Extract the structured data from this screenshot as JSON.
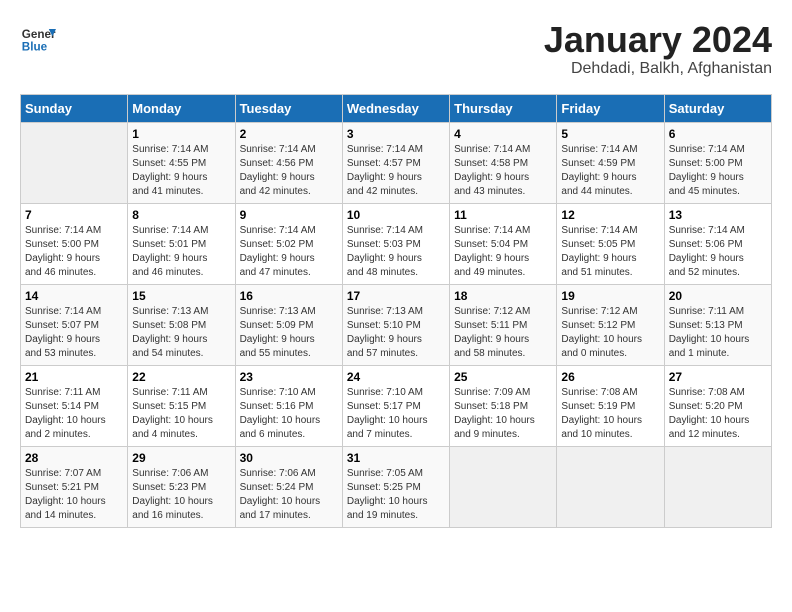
{
  "header": {
    "logo_line1": "General",
    "logo_line2": "Blue",
    "title": "January 2024",
    "subtitle": "Dehdadi, Balkh, Afghanistan"
  },
  "days_of_week": [
    "Sunday",
    "Monday",
    "Tuesday",
    "Wednesday",
    "Thursday",
    "Friday",
    "Saturday"
  ],
  "weeks": [
    [
      {
        "day": "",
        "info": ""
      },
      {
        "day": "1",
        "info": "Sunrise: 7:14 AM\nSunset: 4:55 PM\nDaylight: 9 hours\nand 41 minutes."
      },
      {
        "day": "2",
        "info": "Sunrise: 7:14 AM\nSunset: 4:56 PM\nDaylight: 9 hours\nand 42 minutes."
      },
      {
        "day": "3",
        "info": "Sunrise: 7:14 AM\nSunset: 4:57 PM\nDaylight: 9 hours\nand 42 minutes."
      },
      {
        "day": "4",
        "info": "Sunrise: 7:14 AM\nSunset: 4:58 PM\nDaylight: 9 hours\nand 43 minutes."
      },
      {
        "day": "5",
        "info": "Sunrise: 7:14 AM\nSunset: 4:59 PM\nDaylight: 9 hours\nand 44 minutes."
      },
      {
        "day": "6",
        "info": "Sunrise: 7:14 AM\nSunset: 5:00 PM\nDaylight: 9 hours\nand 45 minutes."
      }
    ],
    [
      {
        "day": "7",
        "info": "Sunrise: 7:14 AM\nSunset: 5:00 PM\nDaylight: 9 hours\nand 46 minutes."
      },
      {
        "day": "8",
        "info": "Sunrise: 7:14 AM\nSunset: 5:01 PM\nDaylight: 9 hours\nand 46 minutes."
      },
      {
        "day": "9",
        "info": "Sunrise: 7:14 AM\nSunset: 5:02 PM\nDaylight: 9 hours\nand 47 minutes."
      },
      {
        "day": "10",
        "info": "Sunrise: 7:14 AM\nSunset: 5:03 PM\nDaylight: 9 hours\nand 48 minutes."
      },
      {
        "day": "11",
        "info": "Sunrise: 7:14 AM\nSunset: 5:04 PM\nDaylight: 9 hours\nand 49 minutes."
      },
      {
        "day": "12",
        "info": "Sunrise: 7:14 AM\nSunset: 5:05 PM\nDaylight: 9 hours\nand 51 minutes."
      },
      {
        "day": "13",
        "info": "Sunrise: 7:14 AM\nSunset: 5:06 PM\nDaylight: 9 hours\nand 52 minutes."
      }
    ],
    [
      {
        "day": "14",
        "info": "Sunrise: 7:14 AM\nSunset: 5:07 PM\nDaylight: 9 hours\nand 53 minutes."
      },
      {
        "day": "15",
        "info": "Sunrise: 7:13 AM\nSunset: 5:08 PM\nDaylight: 9 hours\nand 54 minutes."
      },
      {
        "day": "16",
        "info": "Sunrise: 7:13 AM\nSunset: 5:09 PM\nDaylight: 9 hours\nand 55 minutes."
      },
      {
        "day": "17",
        "info": "Sunrise: 7:13 AM\nSunset: 5:10 PM\nDaylight: 9 hours\nand 57 minutes."
      },
      {
        "day": "18",
        "info": "Sunrise: 7:12 AM\nSunset: 5:11 PM\nDaylight: 9 hours\nand 58 minutes."
      },
      {
        "day": "19",
        "info": "Sunrise: 7:12 AM\nSunset: 5:12 PM\nDaylight: 10 hours\nand 0 minutes."
      },
      {
        "day": "20",
        "info": "Sunrise: 7:11 AM\nSunset: 5:13 PM\nDaylight: 10 hours\nand 1 minute."
      }
    ],
    [
      {
        "day": "21",
        "info": "Sunrise: 7:11 AM\nSunset: 5:14 PM\nDaylight: 10 hours\nand 2 minutes."
      },
      {
        "day": "22",
        "info": "Sunrise: 7:11 AM\nSunset: 5:15 PM\nDaylight: 10 hours\nand 4 minutes."
      },
      {
        "day": "23",
        "info": "Sunrise: 7:10 AM\nSunset: 5:16 PM\nDaylight: 10 hours\nand 6 minutes."
      },
      {
        "day": "24",
        "info": "Sunrise: 7:10 AM\nSunset: 5:17 PM\nDaylight: 10 hours\nand 7 minutes."
      },
      {
        "day": "25",
        "info": "Sunrise: 7:09 AM\nSunset: 5:18 PM\nDaylight: 10 hours\nand 9 minutes."
      },
      {
        "day": "26",
        "info": "Sunrise: 7:08 AM\nSunset: 5:19 PM\nDaylight: 10 hours\nand 10 minutes."
      },
      {
        "day": "27",
        "info": "Sunrise: 7:08 AM\nSunset: 5:20 PM\nDaylight: 10 hours\nand 12 minutes."
      }
    ],
    [
      {
        "day": "28",
        "info": "Sunrise: 7:07 AM\nSunset: 5:21 PM\nDaylight: 10 hours\nand 14 minutes."
      },
      {
        "day": "29",
        "info": "Sunrise: 7:06 AM\nSunset: 5:23 PM\nDaylight: 10 hours\nand 16 minutes."
      },
      {
        "day": "30",
        "info": "Sunrise: 7:06 AM\nSunset: 5:24 PM\nDaylight: 10 hours\nand 17 minutes."
      },
      {
        "day": "31",
        "info": "Sunrise: 7:05 AM\nSunset: 5:25 PM\nDaylight: 10 hours\nand 19 minutes."
      },
      {
        "day": "",
        "info": ""
      },
      {
        "day": "",
        "info": ""
      },
      {
        "day": "",
        "info": ""
      }
    ]
  ]
}
